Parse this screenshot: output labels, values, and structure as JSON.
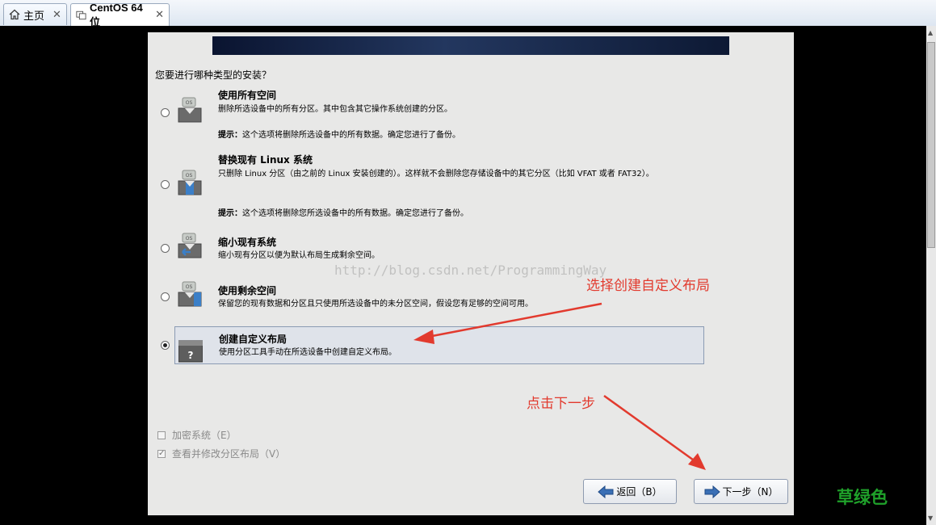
{
  "tabs": [
    {
      "label": "主页",
      "close": "✕",
      "icon": "home-icon"
    },
    {
      "label": "CentOS 64 位",
      "close": "✕",
      "icon": "vm-icon"
    }
  ],
  "installer": {
    "question": "您要进行哪种类型的安装？",
    "options": [
      {
        "title": "使用所有空间",
        "desc": "删除所选设备中的所有分区。其中包含其它操作系统创建的分区。",
        "hint_label": "提示：",
        "hint": "这个选项将删除所选设备中的所有数据。确定您进行了备份。",
        "icon_label": "OS"
      },
      {
        "title": "替换现有 Linux 系统",
        "desc": "只删除 Linux 分区（由之前的 Linux 安装创建的）。这样就不会删除您存储设备中的其它分区（比如 VFAT 或者 FAT32）。",
        "hint_label": "提示：",
        "hint": "这个选项将删除您所选设备中的所有数据。确定您进行了备份。",
        "icon_label": "OS"
      },
      {
        "title": "缩小现有系统",
        "desc": "缩小现有分区以便为默认布局生成剩余空间。",
        "icon_label": "OS"
      },
      {
        "title": "使用剩余空间",
        "desc": "保留您的现有数据和分区且只使用所选设备中的未分区空间，假设您有足够的空间可用。",
        "icon_label": "OS"
      },
      {
        "title": "创建自定义布局",
        "desc": "使用分区工具手动在所选设备中创建自定义布局。",
        "icon_label": "?",
        "selected": true
      }
    ],
    "encrypt_label": "加密系统（E）",
    "review_label": "查看并修改分区布局（V）",
    "back_label": "返回（B）",
    "next_label": "下一步（N）"
  },
  "annotations": {
    "watermark": "http://blog.csdn.net/ProgrammingWay",
    "choose_custom": "选择创建自定义布局",
    "click_next": "点击下一步",
    "green_text": "草绿色",
    "arrow_color": "#e23a2e"
  }
}
